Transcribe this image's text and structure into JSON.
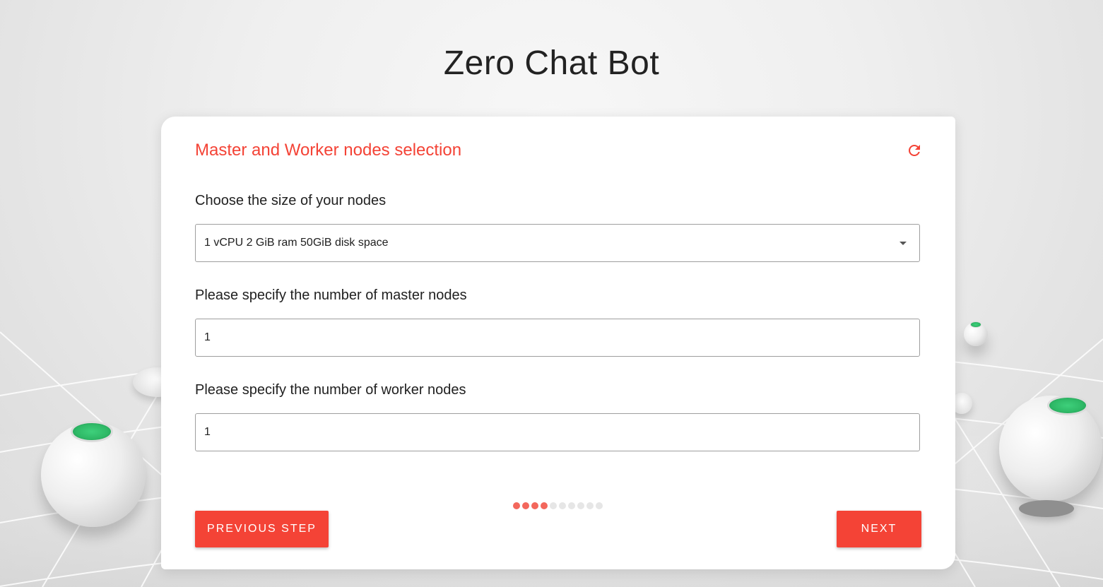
{
  "app": {
    "title": "Zero Chat Bot"
  },
  "card": {
    "title": "Master and Worker nodes selection",
    "refresh_icon": "refresh-icon"
  },
  "node_size": {
    "label": "Choose the size of your nodes",
    "selected": "1 vCPU 2 GiB ram 50GiB disk space"
  },
  "master_nodes": {
    "label": "Please specify the number of master nodes",
    "value": "1"
  },
  "worker_nodes": {
    "label": "Please specify the number of worker nodes",
    "value": "1"
  },
  "progress": {
    "total_steps": 10,
    "completed_steps": 4
  },
  "buttons": {
    "previous": "PREVIOUS STEP",
    "next": "NEXT"
  },
  "colors": {
    "accent": "#f44336",
    "progress_active": "#f3675c",
    "progress_inactive": "#e6e6e6"
  }
}
